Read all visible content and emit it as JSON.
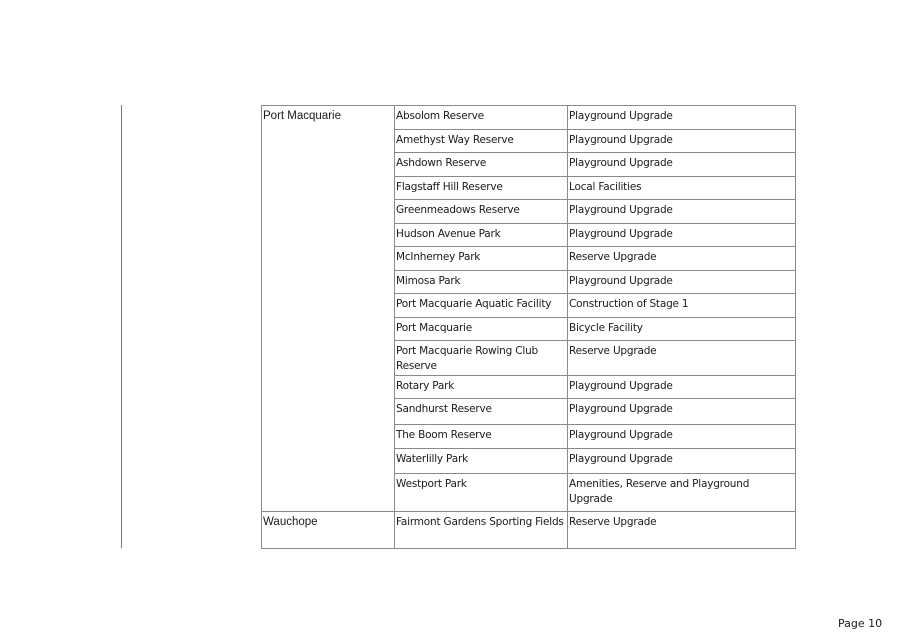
{
  "table": {
    "groups": [
      {
        "town": "Port Macquarie",
        "rows": [
          {
            "location": "Absolom Reserve",
            "project": "Playground Upgrade"
          },
          {
            "location": "Amethyst Way Reserve",
            "project": "Playground Upgrade"
          },
          {
            "location": "Ashdown Reserve",
            "project": "Playground Upgrade"
          },
          {
            "location": "Flagstaff Hill Reserve",
            "project": "Local Facilities"
          },
          {
            "location": "Greenmeadows Reserve",
            "project": "Playground Upgrade"
          },
          {
            "location": "Hudson Avenue Park",
            "project": "Playground Upgrade"
          },
          {
            "location": "McInherney Park",
            "project": "Reserve Upgrade"
          },
          {
            "location": "Mimosa Park",
            "project": "Playground Upgrade"
          },
          {
            "location": "Port Macquarie Aquatic Facility",
            "project": "Construction of Stage 1"
          },
          {
            "location": "Port Macquarie",
            "project": "Bicycle Facility"
          },
          {
            "location": "Port Macquarie Rowing Club Reserve",
            "project": "Reserve Upgrade"
          },
          {
            "location": "Rotary Park",
            "project": "Playground Upgrade"
          },
          {
            "location": "Sandhurst Reserve",
            "project": "Playground Upgrade"
          },
          {
            "location": "The Boom Reserve",
            "project": "Playground Upgrade"
          },
          {
            "location": "Waterlilly Park",
            "project": "Playground Upgrade"
          },
          {
            "location": "Westport Park",
            "project": "Amenities, Reserve and Playground Upgrade"
          }
        ]
      },
      {
        "town": "Wauchope",
        "rows": [
          {
            "location": "Fairmont Gardens Sporting Fields",
            "project": "Reserve Upgrade"
          }
        ]
      }
    ]
  },
  "footer": {
    "page_label": "Page 10"
  }
}
